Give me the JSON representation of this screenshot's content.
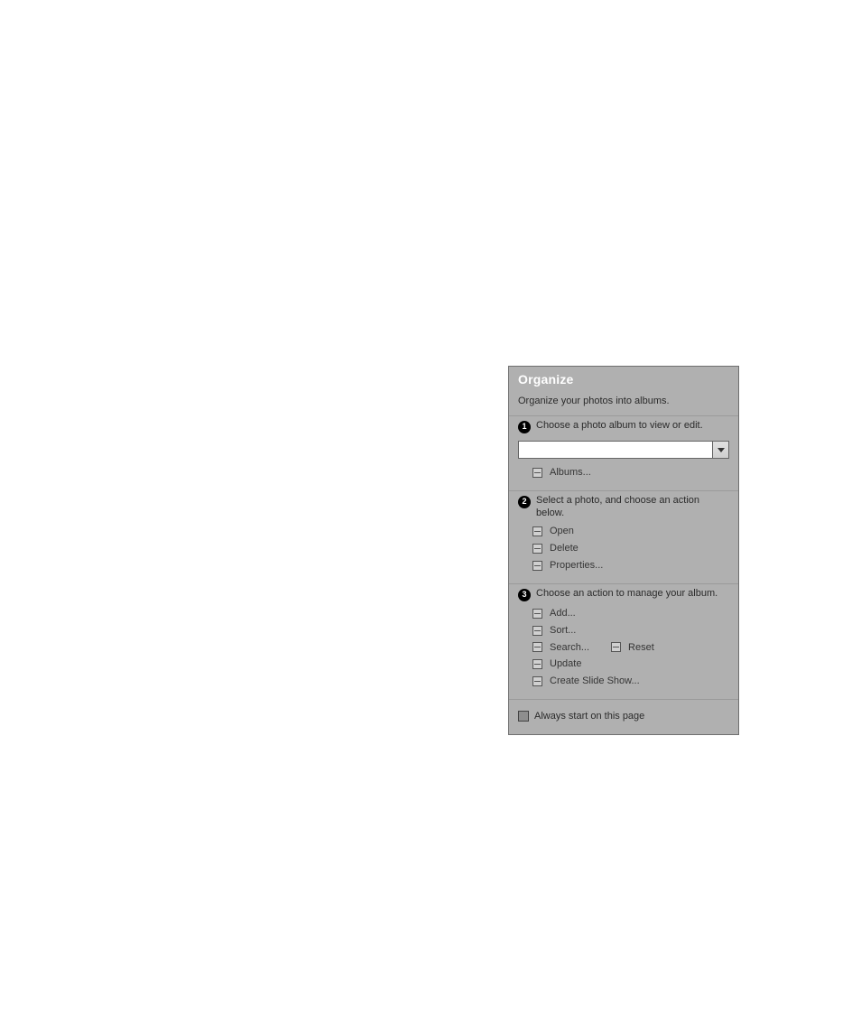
{
  "panel": {
    "title": "Organize",
    "subtitle": "Organize your photos into albums.",
    "step1": {
      "num": "1",
      "text": "Choose a photo album to view or edit.",
      "albums_link": "Albums..."
    },
    "step2": {
      "num": "2",
      "text": "Select a photo, and choose an action below.",
      "open": "Open",
      "delete": "Delete",
      "properties": "Properties..."
    },
    "step3": {
      "num": "3",
      "text": "Choose an action to manage your album.",
      "add": "Add...",
      "sort": "Sort...",
      "search": "Search...",
      "reset": "Reset",
      "update": "Update",
      "create_slide": "Create Slide Show..."
    },
    "footer": "Always start on this page"
  }
}
